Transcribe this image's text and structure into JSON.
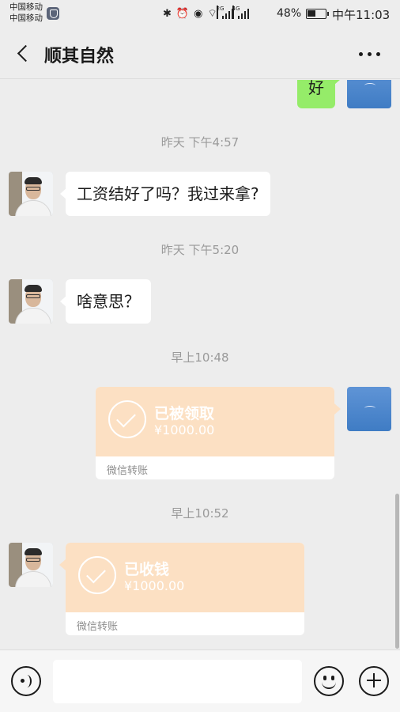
{
  "status_bar": {
    "carrier_1": "中国移动",
    "carrier_2": "中国移动",
    "network_tag_1": "2G",
    "network_tag_2": "4G",
    "battery": "48%",
    "time": "中午11:03"
  },
  "header": {
    "title": "顺其自然"
  },
  "messages": [
    {
      "type": "text",
      "direction": "out",
      "text": "好"
    },
    {
      "type": "time",
      "text": "昨天 下午4:57"
    },
    {
      "type": "text",
      "direction": "in",
      "text": "工资结好了吗？我过来拿?"
    },
    {
      "type": "time",
      "text": "昨天 下午5:20"
    },
    {
      "type": "text",
      "direction": "in",
      "text": "啥意思？"
    },
    {
      "type": "time",
      "text": "早上10:48"
    },
    {
      "type": "transfer",
      "direction": "out",
      "status": "已被领取",
      "amount": "¥1000.00",
      "label": "微信转账"
    },
    {
      "type": "time",
      "text": "早上10:52"
    },
    {
      "type": "transfer",
      "direction": "in",
      "status": "已收钱",
      "amount": "¥1000.00",
      "label": "微信转账"
    }
  ],
  "input_bar": {
    "placeholder": ""
  },
  "colors": {
    "background": "#ededed",
    "sent_bubble": "#95ec69",
    "transfer_card": "#fce0c3"
  }
}
